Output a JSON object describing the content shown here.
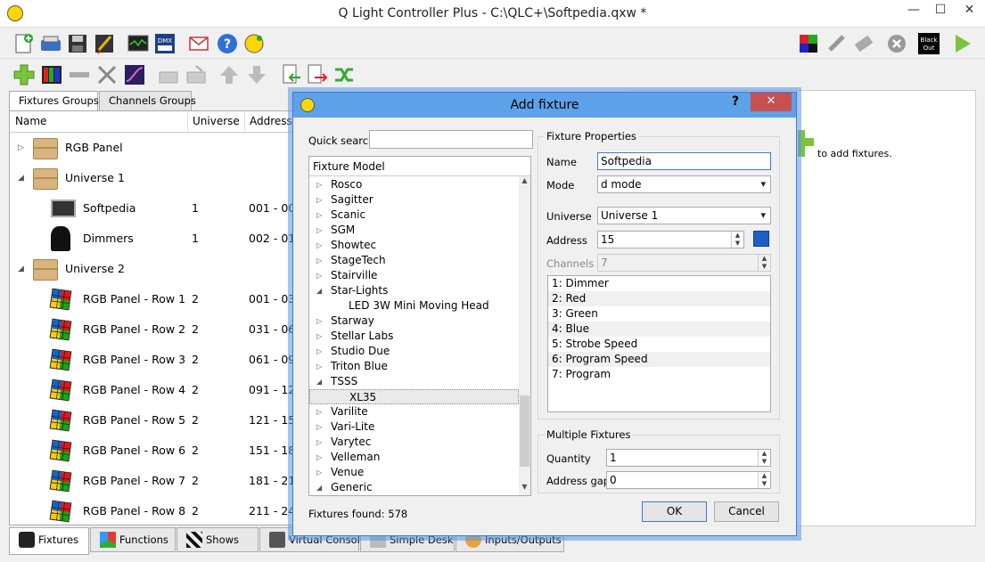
{
  "window": {
    "title": "Q Light Controller Plus - C:\\QLC+\\Softpedia.qxw *",
    "min_label": "—",
    "max_label": "☐",
    "close_label": "✕"
  },
  "left_tabs": [
    "Fixtures Groups",
    "Channels Groups"
  ],
  "tree": {
    "columns": [
      "Name",
      "Universe",
      "Address"
    ],
    "rows": [
      {
        "name": "RGB Panel",
        "universe": "",
        "address": "",
        "level": 0,
        "expanded": false,
        "icon": "folder-icon"
      },
      {
        "name": "Universe 1",
        "universe": "",
        "address": "",
        "level": 0,
        "expanded": true,
        "icon": "folder-icon"
      },
      {
        "name": "Softpedia",
        "universe": "1",
        "address": "001 - 00",
        "level": 1,
        "icon": "fixture-icon"
      },
      {
        "name": "Dimmers",
        "universe": "1",
        "address": "002 - 01",
        "level": 1,
        "icon": "moving-head-icon"
      },
      {
        "name": "Universe 2",
        "universe": "",
        "address": "",
        "level": 0,
        "expanded": true,
        "icon": "folder-icon"
      },
      {
        "name": "RGB Panel - Row 1",
        "universe": "2",
        "address": "001 - 03",
        "level": 1,
        "icon": "rgb-cube-icon"
      },
      {
        "name": "RGB Panel - Row 2",
        "universe": "2",
        "address": "031 - 06",
        "level": 1,
        "icon": "rgb-cube-icon"
      },
      {
        "name": "RGB Panel - Row 3",
        "universe": "2",
        "address": "061 - 09",
        "level": 1,
        "icon": "rgb-cube-icon"
      },
      {
        "name": "RGB Panel - Row 4",
        "universe": "2",
        "address": "091 - 12",
        "level": 1,
        "icon": "rgb-cube-icon"
      },
      {
        "name": "RGB Panel - Row 5",
        "universe": "2",
        "address": "121 - 15",
        "level": 1,
        "icon": "rgb-cube-icon"
      },
      {
        "name": "RGB Panel - Row 6",
        "universe": "2",
        "address": "151 - 18",
        "level": 1,
        "icon": "rgb-cube-icon"
      },
      {
        "name": "RGB Panel - Row 7",
        "universe": "2",
        "address": "181 - 21",
        "level": 1,
        "icon": "rgb-cube-icon"
      },
      {
        "name": "RGB Panel - Row 8",
        "universe": "2",
        "address": "211 - 24",
        "level": 1,
        "icon": "rgb-cube-icon"
      }
    ]
  },
  "right_hint": "to add fixtures.",
  "bottom_tabs": [
    {
      "label": "Fixtures",
      "icon": "spotlight-icon"
    },
    {
      "label": "Functions",
      "icon": "functions-icon"
    },
    {
      "label": "Shows",
      "icon": "clapperboard-icon"
    },
    {
      "label": "Virtual Console",
      "icon": "console-icon"
    },
    {
      "label": "Simple Desk",
      "icon": "desk-icon"
    },
    {
      "label": "Inputs/Outputs",
      "icon": "io-icon"
    }
  ],
  "dialog": {
    "title": "Add fixture",
    "help": "?",
    "close": "✕",
    "quick_search_label": "Quick search",
    "quick_search_value": "",
    "model_header": "Fixture Model",
    "models": [
      {
        "label": "Rosco",
        "arrow": "▷"
      },
      {
        "label": "Sagitter",
        "arrow": "▷"
      },
      {
        "label": "Scanic",
        "arrow": "▷"
      },
      {
        "label": "SGM",
        "arrow": "▷"
      },
      {
        "label": "Showtec",
        "arrow": "▷"
      },
      {
        "label": "StageTech",
        "arrow": "▷"
      },
      {
        "label": "Stairville",
        "arrow": "▷"
      },
      {
        "label": "Star-Lights",
        "arrow": "◢"
      },
      {
        "label": "LED 3W Mini Moving Head",
        "arrow": "",
        "child": true
      },
      {
        "label": "Starway",
        "arrow": "▷"
      },
      {
        "label": "Stellar Labs",
        "arrow": "▷"
      },
      {
        "label": "Studio Due",
        "arrow": "▷"
      },
      {
        "label": "Triton Blue",
        "arrow": "▷"
      },
      {
        "label": "TSSS",
        "arrow": "◢"
      },
      {
        "label": "XL35",
        "arrow": "",
        "child": true,
        "selected": true
      },
      {
        "label": "Varilite",
        "arrow": "▷"
      },
      {
        "label": "Vari-Lite",
        "arrow": "▷"
      },
      {
        "label": "Varytec",
        "arrow": "▷"
      },
      {
        "label": "Velleman",
        "arrow": "▷"
      },
      {
        "label": "Venue",
        "arrow": "▷"
      },
      {
        "label": "Generic",
        "arrow": "◢"
      }
    ],
    "fixtures_found": "Fixtures found: 578",
    "props": {
      "group_title": "Fixture Properties",
      "name_label": "Name",
      "name_value": "Softpedia",
      "mode_label": "Mode",
      "mode_value": "d mode",
      "universe_label": "Universe",
      "universe_value": "Universe 1",
      "address_label": "Address",
      "address_value": "15",
      "channels_label": "Channels",
      "channels_value": "7",
      "channel_list": [
        "1: Dimmer",
        "2: Red",
        "3: Green",
        "4: Blue",
        "5: Strobe Speed",
        "6: Program Speed",
        "7: Program"
      ]
    },
    "multiple": {
      "group_title": "Multiple Fixtures",
      "quantity_label": "Quantity",
      "quantity_value": "1",
      "gap_label": "Address gap",
      "gap_value": "0"
    },
    "ok_label": "OK",
    "cancel_label": "Cancel"
  }
}
